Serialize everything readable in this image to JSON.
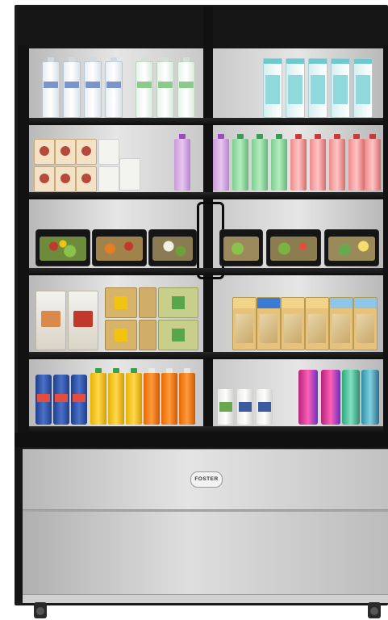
{
  "product": {
    "brand_badge": "FOSTER"
  },
  "colors": {
    "frame": "#1c1c1c",
    "glass_interior": "#d8d8d8",
    "steel": "#c4c4c4"
  }
}
